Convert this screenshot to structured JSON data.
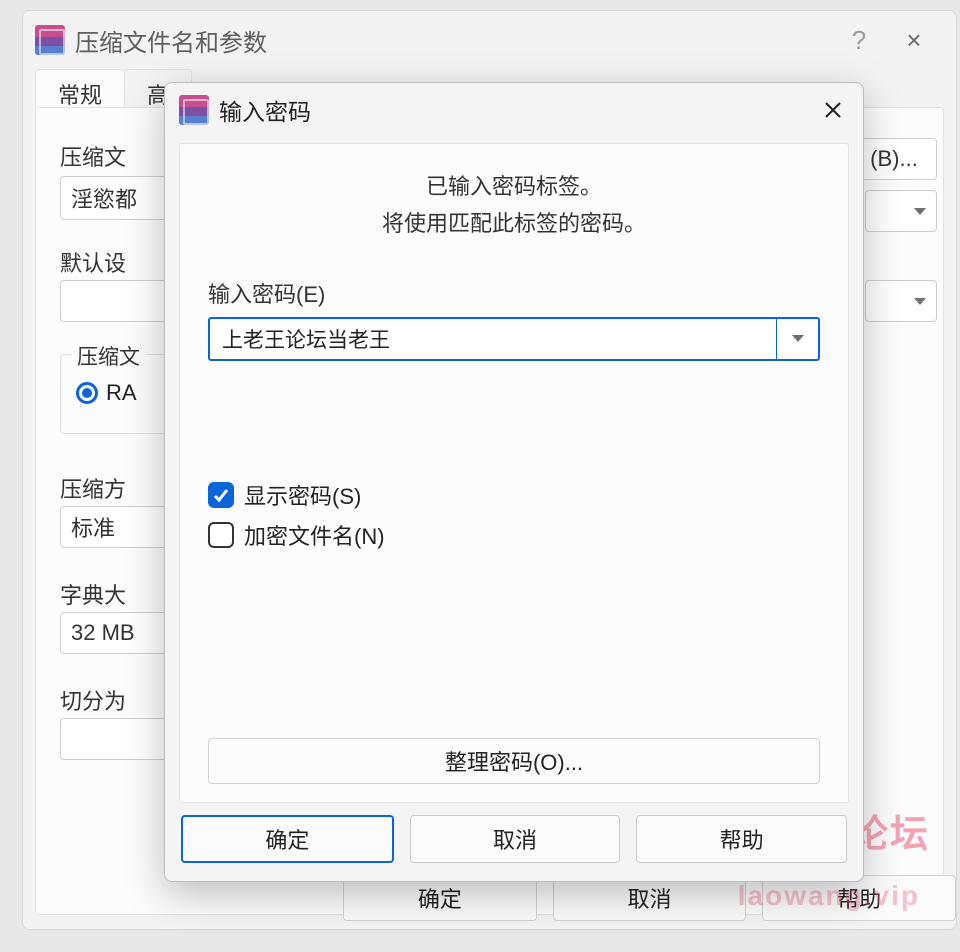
{
  "bg": {
    "title": "压缩文件名和参数",
    "help_icon": "?",
    "close_icon": "×",
    "tabs": {
      "general": "常规",
      "advanced_partial": "高"
    },
    "labels": {
      "filename": "压缩文",
      "filename_value_partial": "淫慾都",
      "default_settings": "默认设",
      "format_group": "压缩文",
      "format_radio": "RA",
      "method": "压缩方",
      "method_value": "标准",
      "dict": "字典大",
      "dict_value": "32 MB",
      "split": "切分为"
    },
    "right_btn_partial": "(B)...",
    "buttons": {
      "ok": "确定",
      "cancel": "取消",
      "help": "帮助"
    }
  },
  "modal": {
    "title": "输入密码",
    "message_line1": "已输入密码标签。",
    "message_line2": "将使用匹配此标签的密码。",
    "password_label": "输入密码(E)",
    "password_value": "上老王论坛当老王",
    "show_password_label": "显示密码(S)",
    "show_password_checked": true,
    "encrypt_names_label": "加密文件名(N)",
    "encrypt_names_checked": false,
    "organize_button": "整理密码(O)...",
    "buttons": {
      "ok": "确定",
      "cancel": "取消",
      "help": "帮助"
    }
  },
  "watermark": {
    "line1": "老王论坛",
    "line2": "laowang.vip"
  }
}
